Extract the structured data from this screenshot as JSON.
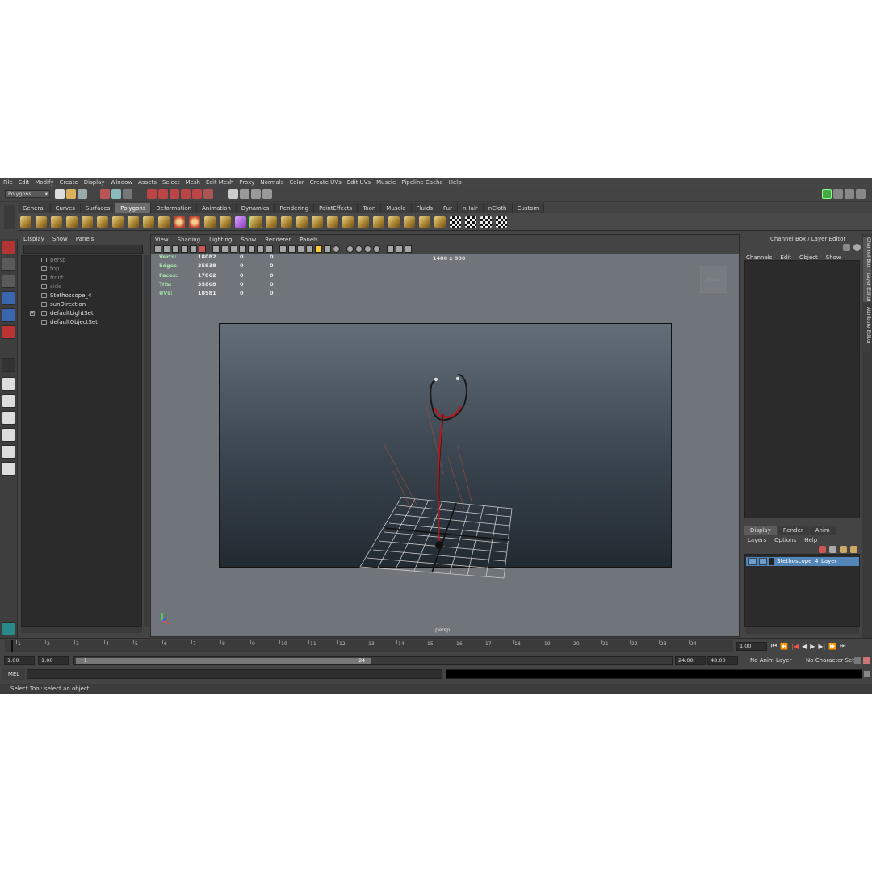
{
  "menubar": [
    "File",
    "Edit",
    "Modify",
    "Create",
    "Display",
    "Window",
    "Assets",
    "Select",
    "Mesh",
    "Edit Mesh",
    "Proxy",
    "Normals",
    "Color",
    "Create UVs",
    "Edit UVs",
    "Muscle",
    "Pipeline Cache",
    "Help"
  ],
  "status": {
    "mode": "Polygons"
  },
  "shelf_tabs": [
    "General",
    "Curves",
    "Surfaces",
    "Polygons",
    "Deformation",
    "Animation",
    "Dynamics",
    "Rendering",
    "PaintEffects",
    "Toon",
    "Muscle",
    "Fluids",
    "Fur",
    "nHair",
    "nCloth",
    "Custom"
  ],
  "shelf_active": "Polygons",
  "outliner": {
    "menu": [
      "Display",
      "Show",
      "Panels"
    ],
    "items": [
      {
        "label": "persp",
        "dim": true
      },
      {
        "label": "top",
        "dim": true
      },
      {
        "label": "front",
        "dim": true
      },
      {
        "label": "side",
        "dim": true
      },
      {
        "label": "Stethoscope_4",
        "dim": false
      },
      {
        "label": "sunDirection",
        "dim": false
      },
      {
        "label": "defaultLightSet",
        "dim": false
      },
      {
        "label": "defaultObjectSet",
        "dim": false
      }
    ]
  },
  "viewport": {
    "menu": [
      "View",
      "Shading",
      "Lighting",
      "Show",
      "Renderer",
      "Panels"
    ],
    "resolution": "1480 x 800",
    "camera": "persp",
    "cube_label": "FRONT",
    "hud": [
      {
        "label": "Verts:",
        "v1": "18082",
        "v2": "0",
        "v3": "0"
      },
      {
        "label": "Edges:",
        "v1": "35938",
        "v2": "0",
        "v3": "0"
      },
      {
        "label": "Faces:",
        "v1": "17862",
        "v2": "0",
        "v3": "0"
      },
      {
        "label": "Tris:",
        "v1": "35808",
        "v2": "0",
        "v3": "0"
      },
      {
        "label": "UVs:",
        "v1": "18981",
        "v2": "0",
        "v3": "0"
      }
    ]
  },
  "channelbox": {
    "title": "Channel Box / Layer Editor",
    "menu": [
      "Channels",
      "Edit",
      "Object",
      "Show"
    ],
    "layer_tabs": [
      "Display",
      "Render",
      "Anim"
    ],
    "layer_menu": [
      "Layers",
      "Options",
      "Help"
    ],
    "layer_name": "Stethoscope_4_Layer"
  },
  "side_tabs": [
    "Channel Box / Layer Editor",
    "Attribute Editor"
  ],
  "timeline": {
    "ticks": [
      "1",
      "2",
      "3",
      "4",
      "5",
      "6",
      "7",
      "8",
      "9",
      "10",
      "11",
      "12",
      "13",
      "14",
      "15",
      "16",
      "17",
      "18",
      "19",
      "20",
      "21",
      "22",
      "23",
      "24"
    ],
    "current": "1.00"
  },
  "range": {
    "start": "1.00",
    "inner_start": "1.00",
    "slider_start": "1",
    "slider_end": "24",
    "end": "24.00",
    "outer_end": "48.00",
    "anim_layer": "No Anim Layer",
    "char_set": "No Character Set"
  },
  "cmd": {
    "label": "MEL"
  },
  "help_text": "Select Tool: select an object"
}
